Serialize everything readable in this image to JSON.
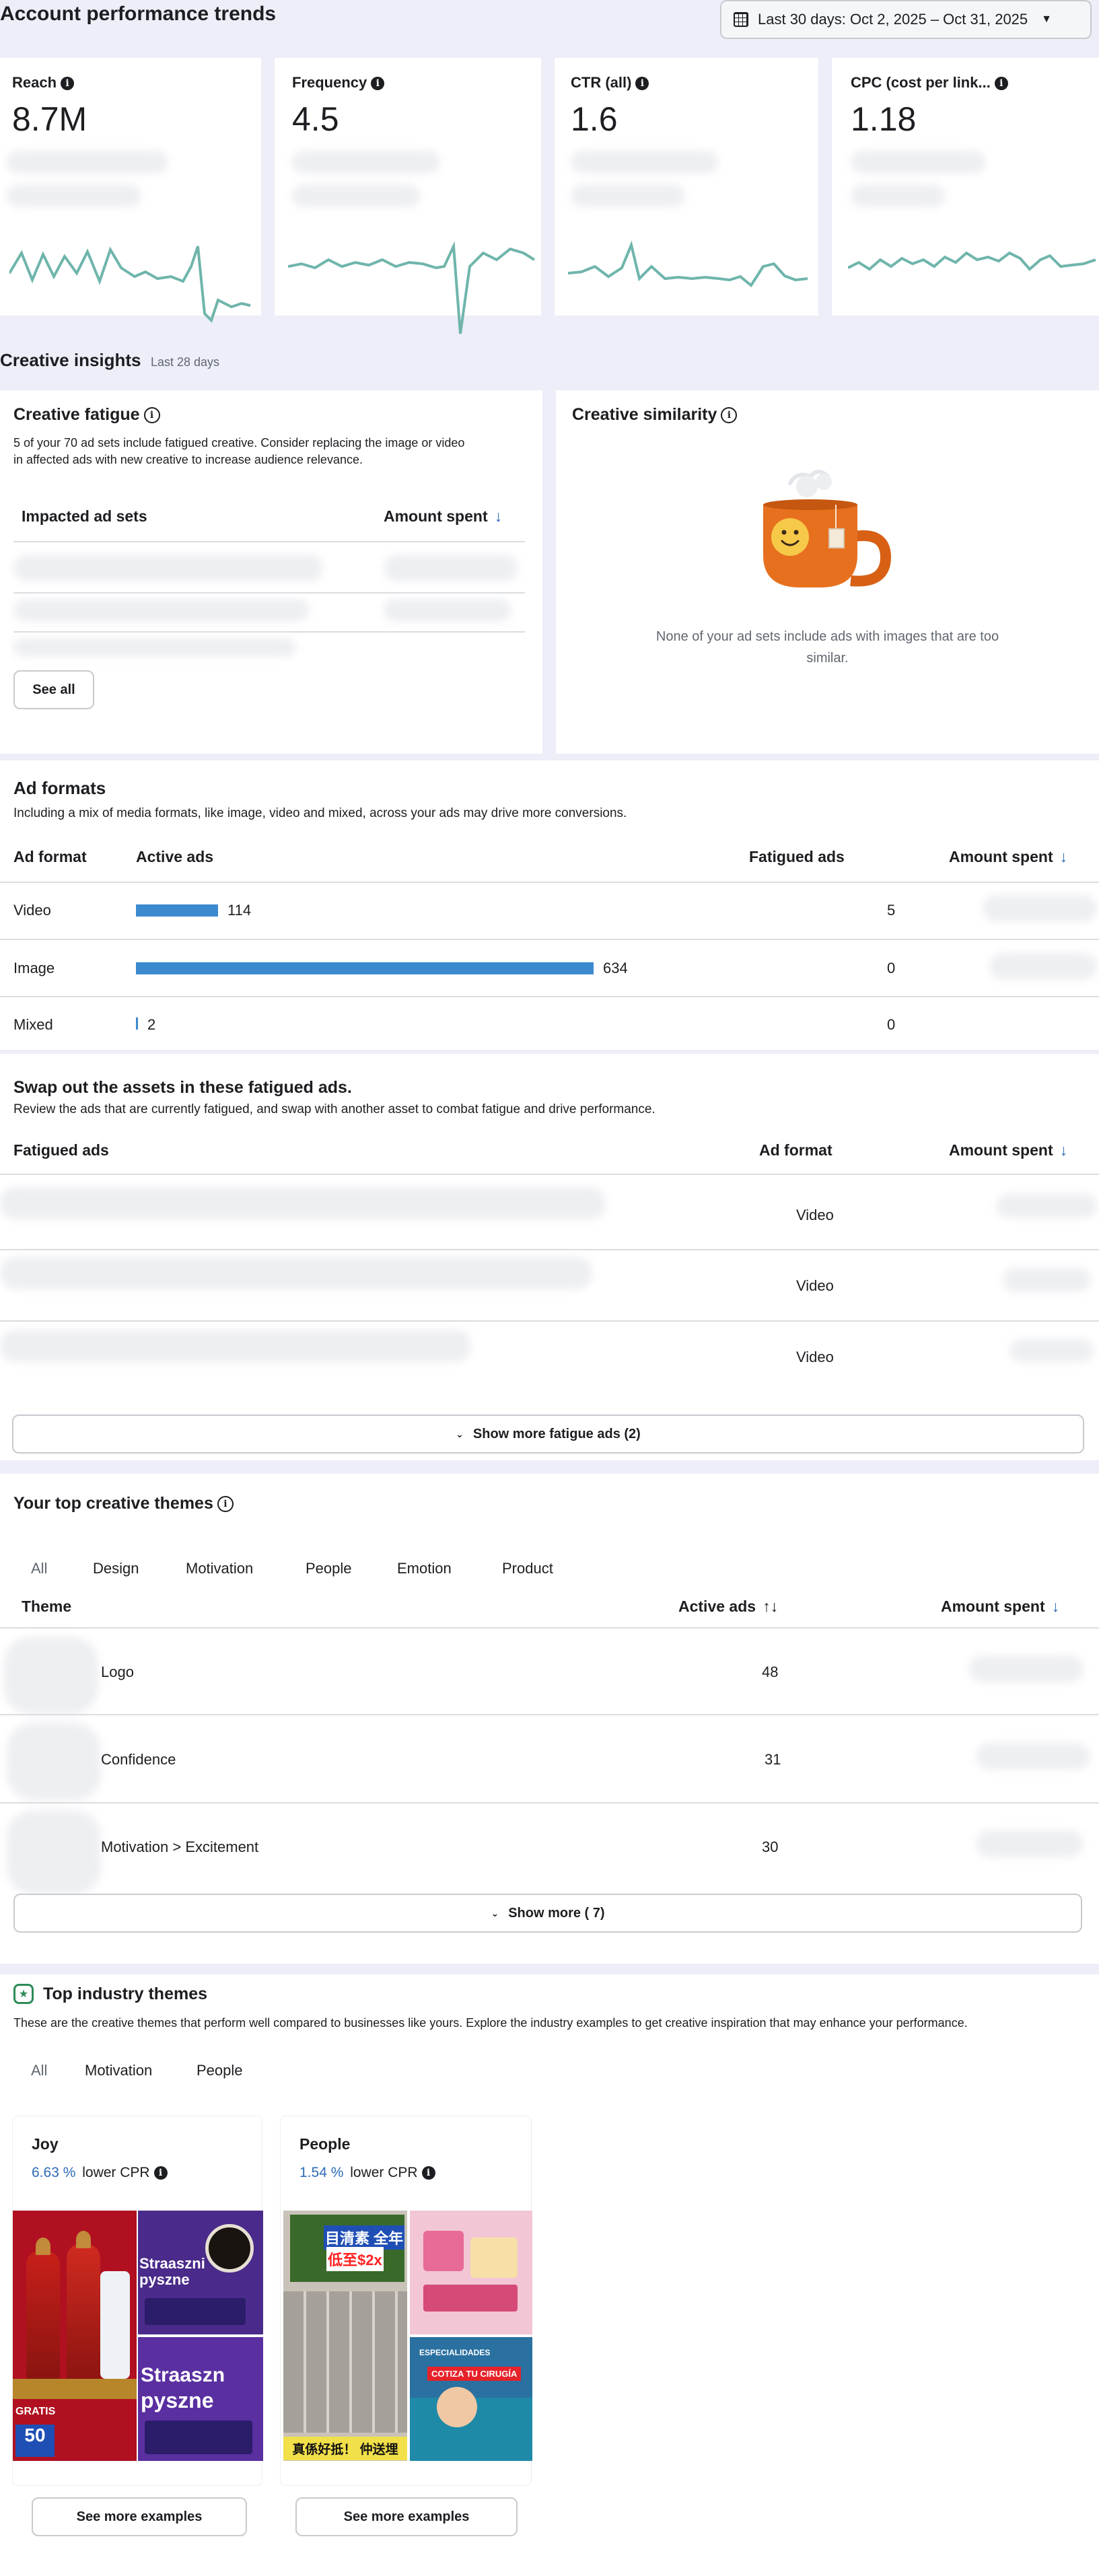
{
  "header": {
    "title": "Account performance trends",
    "date_range": "Last 30 days: Oct 2, 2025 – Oct 31, 2025"
  },
  "metrics": [
    {
      "label": "Reach",
      "value": "8.7M"
    },
    {
      "label": "Frequency",
      "value": "4.5"
    },
    {
      "label": "CTR (all)",
      "value": "1.6"
    },
    {
      "label": "CPC (cost per link...",
      "value": "1.18"
    }
  ],
  "creative_insights": {
    "title": "Creative insights",
    "period": "Last 28 days",
    "fatigue": {
      "title": "Creative fatigue",
      "description_line1": "5 of your 70 ad sets include fatigued creative. Consider replacing the image or video",
      "description_line2": "in affected ads with new creative to increase audience relevance.",
      "col_adsets": "Impacted ad sets",
      "col_amount": "Amount spent",
      "see_all": "See all"
    },
    "similarity": {
      "title": "Creative similarity",
      "empty_line1": "None of your ad sets include ads with images that are too",
      "empty_line2": "similar."
    }
  },
  "ad_formats": {
    "title": "Ad formats",
    "subtitle": "Including a mix of media formats, like image, video and mixed, across your ads may drive more conversions.",
    "columns": [
      "Ad format",
      "Active ads",
      "Fatigued ads",
      "Amount spent"
    ],
    "rows": [
      {
        "format": "Video",
        "active": "114",
        "active_num": 114,
        "fatigued": "5"
      },
      {
        "format": "Image",
        "active": "634",
        "active_num": 634,
        "fatigued": "0"
      },
      {
        "format": "Mixed",
        "active": "2",
        "active_num": 2,
        "fatigued": "0"
      }
    ]
  },
  "swap": {
    "title": "Swap out the assets in these fatigued ads.",
    "subtitle": "Review the ads that are currently fatigued, and swap with another asset to combat fatigue and drive performance.",
    "columns": [
      "Fatigued ads",
      "Ad format",
      "Amount spent"
    ],
    "rows": [
      {
        "format": "Video"
      },
      {
        "format": "Video"
      },
      {
        "format": "Video"
      }
    ],
    "show_more": "Show more fatigue ads (2)"
  },
  "themes": {
    "title": "Your top creative themes",
    "tabs": [
      "All",
      "Design",
      "Motivation",
      "People",
      "Emotion",
      "Product"
    ],
    "columns": [
      "Theme",
      "Active ads",
      "Amount spent"
    ],
    "rows": [
      {
        "name": "Logo",
        "active": "48"
      },
      {
        "name": "Confidence",
        "active": "31"
      },
      {
        "name": "Motivation > Excitement",
        "active": "30"
      }
    ],
    "show_more": "Show more ( 7)"
  },
  "industry": {
    "title": "Top industry themes",
    "subtitle": "These are the creative themes that perform well compared to businesses like yours. Explore the industry examples to get creative inspiration that may enhance your performance.",
    "tabs": [
      "All",
      "Motivation",
      "People"
    ],
    "cards": [
      {
        "name": "Joy",
        "pct": "6.63 %",
        "metric": "lower CPR",
        "button": "See more examples",
        "img_text1": "Straaszni",
        "img_text2": "pyszne",
        "img_text3": "Straaszn",
        "img_text4": "pyszne",
        "img_text5": "GRATIS",
        "img_text6": "50"
      },
      {
        "name": "People",
        "pct": "1.54 %",
        "metric": "lower CPR",
        "button": "See more examples",
        "img_text1": "目清素 全年",
        "img_text2": "低至$2x",
        "img_text3": "真係好抵！ 仲送埋",
        "img_text4": "COTIZA TU CIRUGÍA",
        "img_text5": "ESPECIALIDADES"
      }
    ]
  },
  "colors": {
    "accent": "#2e6bb8",
    "bar": "#3b8ad0",
    "spark": "#6fb5ab",
    "bg": "#edeef7",
    "mug": "#e7701f"
  }
}
